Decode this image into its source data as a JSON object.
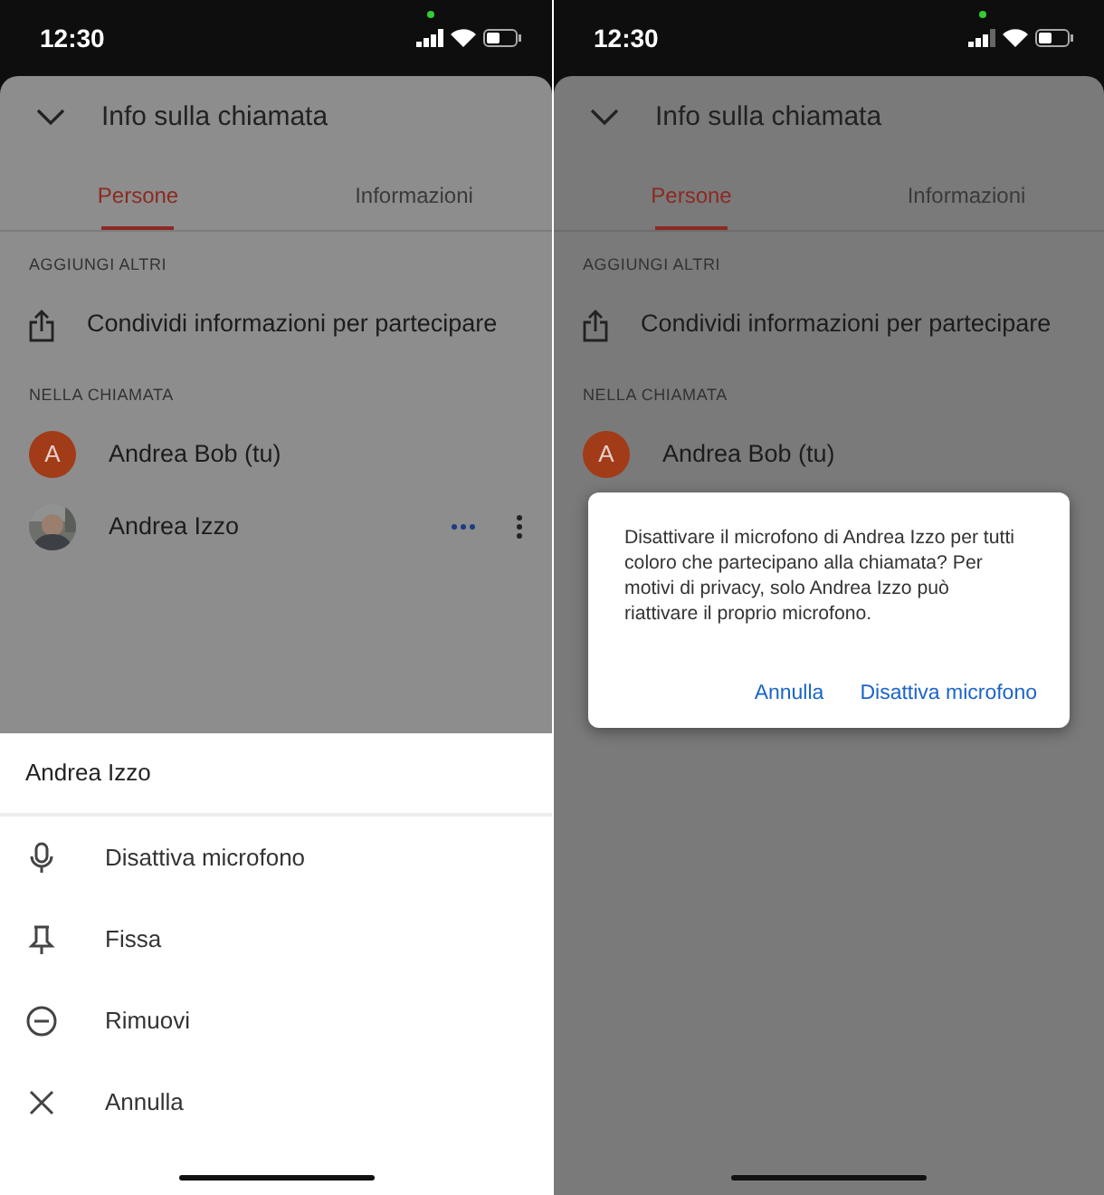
{
  "panels": [
    {
      "status_bar": {
        "time": "12:30"
      },
      "header": {
        "title": "Info sulla chiamata"
      },
      "tabs": [
        {
          "label": "Persone",
          "selected": true
        },
        {
          "label": "Informazioni",
          "selected": false
        }
      ],
      "sections": [
        {
          "heading": "AGGIUNGI ALTRI",
          "items": [
            {
              "kind": "action",
              "label": "Condividi informazioni per partecipare"
            }
          ]
        },
        {
          "heading": "NELLA CHIAMATA",
          "items": [
            {
              "kind": "person",
              "avatar": {
                "kind": "letter",
                "initial": "A"
              },
              "label": "Andrea Bob (tu)"
            },
            {
              "kind": "person",
              "label": "Andrea Izzo",
              "talking": true,
              "more_menu": true
            }
          ]
        }
      ],
      "sheet": {
        "title": "Andrea Izzo",
        "items": [
          {
            "kind": "mic",
            "label": "Disattiva microfono"
          },
          {
            "kind": "pin",
            "label": "Fissa"
          },
          {
            "kind": "remove",
            "label": "Rimuovi"
          },
          {
            "kind": "close",
            "label": "Annulla"
          }
        ]
      }
    },
    {
      "status_bar": {
        "time": "12:30"
      },
      "header": {
        "title": "Info sulla chiamata"
      },
      "tabs": [
        {
          "label": "Persone",
          "selected": true
        },
        {
          "label": "Informazioni",
          "selected": false
        }
      ],
      "sections": [
        {
          "heading": "AGGIUNGI ALTRI",
          "items": [
            {
              "kind": "action",
              "label": "Condividi informazioni per partecipare"
            }
          ]
        },
        {
          "heading": "NELLA CHIAMATA",
          "items": [
            {
              "kind": "person",
              "avatar": {
                "kind": "letter",
                "initial": "A"
              },
              "label": "Andrea Bob (tu)"
            }
          ]
        }
      ],
      "dialog": {
        "message": "Disattivare il microfono di Andrea Izzo per tutti coloro che partecipano alla chiamata? Per motivi di privacy, solo Andrea Izzo può riattivare il proprio microfono.",
        "buttons": [
          "Annulla",
          "Disattiva microfono"
        ]
      }
    }
  ]
}
